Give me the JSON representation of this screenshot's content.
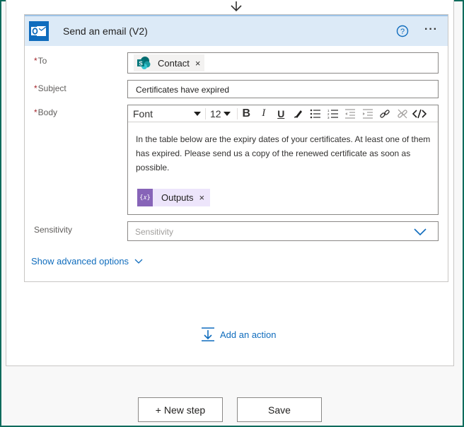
{
  "action_card": {
    "title": "Send an email (V2)",
    "more_label": "···"
  },
  "fields": {
    "to": {
      "label": "To",
      "required_mark": "*",
      "token_label": "Contact",
      "token_remove": "×"
    },
    "subject": {
      "label": "Subject",
      "required_mark": "*",
      "value": "Certificates have expired"
    },
    "body": {
      "label": "Body",
      "required_mark": "*",
      "toolbar": {
        "font": "Font",
        "size": "12"
      },
      "text": "In the table below are the expiry dates of your certificates. At least one of them has expired. Please send us a copy of the renewed certificate as soon as possible.",
      "token_label": "Outputs",
      "token_remove": "×"
    },
    "sensitivity": {
      "label": "Sensitivity",
      "placeholder": "Sensitivity"
    }
  },
  "show_advanced_label": "Show advanced options",
  "add_action_label": "Add an action",
  "buttons": {
    "new_step": "+ New step",
    "save": "Save"
  },
  "colors": {
    "accent": "#0f6cbd",
    "header_bg": "#dceaf7",
    "required": "#a4262c",
    "expression_token": "#8764b8",
    "frame_border": "#0e6b5c"
  },
  "icons": {
    "connector": "outlook-icon",
    "help": "help-icon",
    "to_token": "sharepoint-icon",
    "body_token": "expression-icon"
  }
}
